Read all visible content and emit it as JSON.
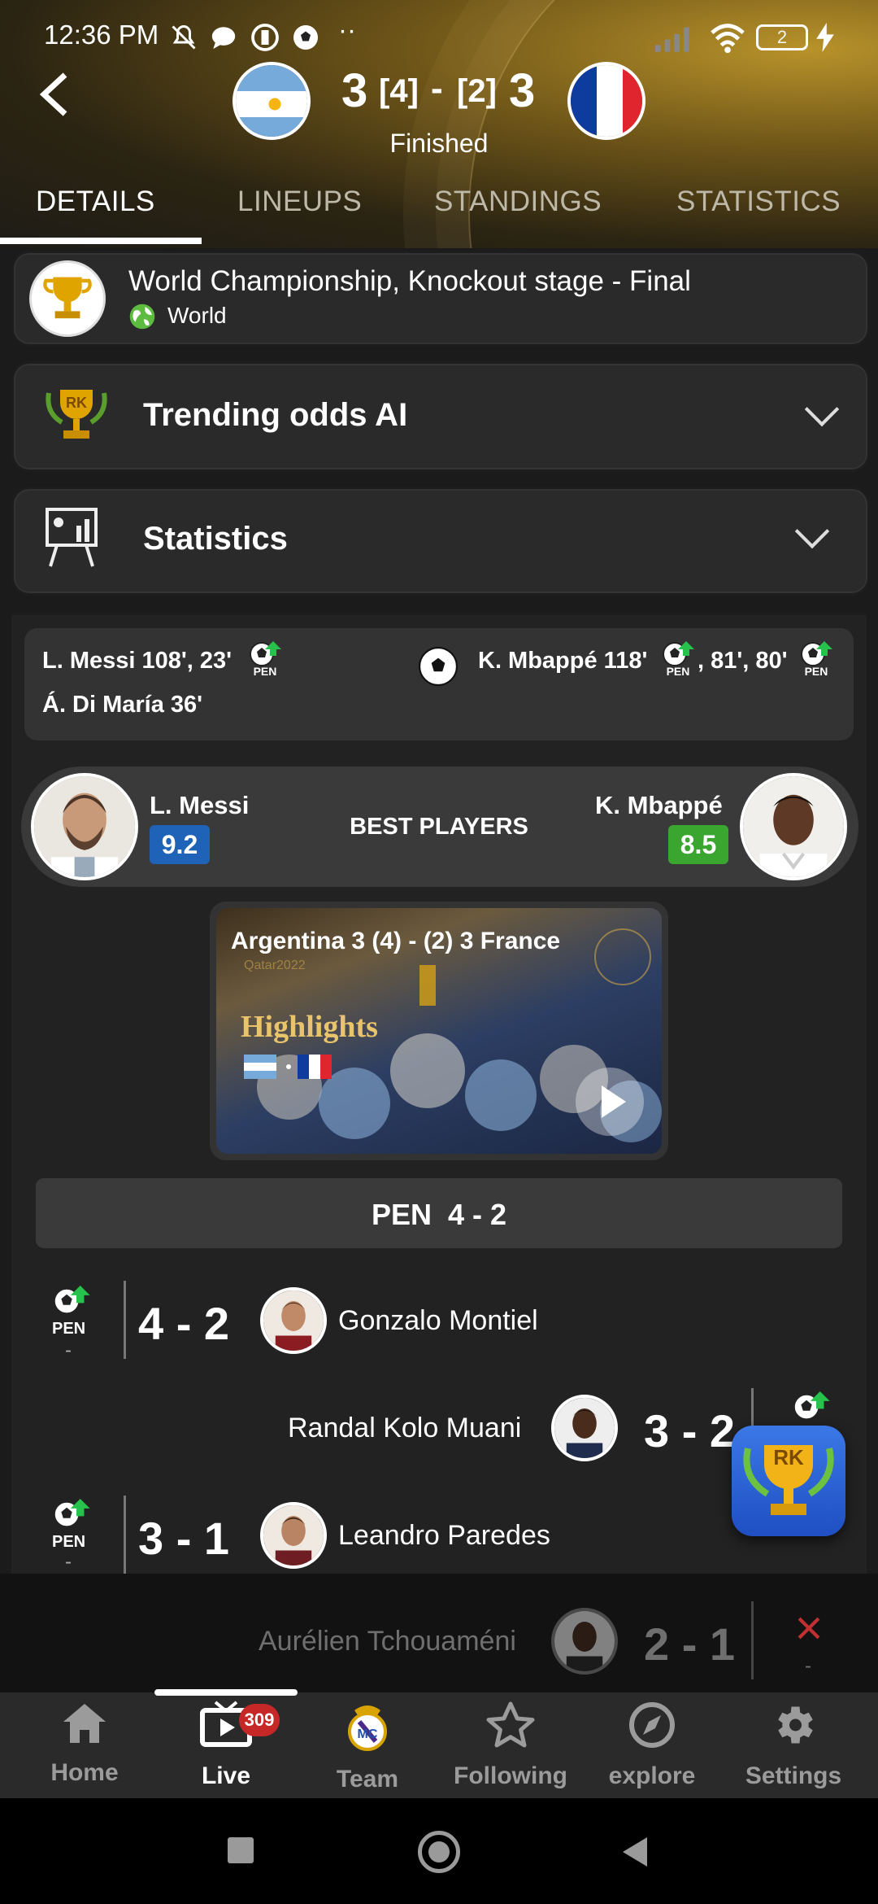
{
  "status_bar": {
    "time": "12:36 PM",
    "dots": "··",
    "battery": "2"
  },
  "match": {
    "home_score": "3",
    "away_score": "3",
    "home_pen": "[4]",
    "away_pen": "[2]",
    "separator": "-",
    "status": "Finished"
  },
  "tabs": [
    "DETAILS",
    "LINEUPS",
    "STANDINGS",
    "STATISTICS"
  ],
  "competition": {
    "title": "World Championship, Knockout stage - Final",
    "region": "World"
  },
  "trending": {
    "label": "Trending odds AI"
  },
  "statistics": {
    "label": "Statistics"
  },
  "scorers": {
    "home_line1": "L. Messi 108', 23'",
    "home_line2": "Á. Di María 36'",
    "away_line1_a": "K. Mbappé 118'",
    "away_line1_b": ", 81', 80'"
  },
  "best_players": {
    "label": "BEST PLAYERS",
    "home_name": "L. Messi",
    "home_rating": "9.2",
    "away_name": "K. Mbappé",
    "away_rating": "8.5"
  },
  "highlights": {
    "caption": "Argentina 3 (4) - (2) 3 France",
    "overlay": "Highlights",
    "watermark": "Qatar2022"
  },
  "penalties": {
    "header": "PEN  4 - 2",
    "pen_label": "PEN",
    "rows": [
      {
        "side": "home",
        "score": "4 - 2",
        "player": "Gonzalo Montiel",
        "note": "-"
      },
      {
        "side": "away",
        "score": "3 - 2",
        "player": "Randal Kolo Muani",
        "note": "-"
      },
      {
        "side": "home",
        "score": "3 - 1",
        "player": "Leandro Paredes",
        "note": "-"
      },
      {
        "side": "away",
        "score": "2 - 1",
        "player": "Aurélien Tchouaméni",
        "note": "-",
        "missed": true
      }
    ]
  },
  "fab": {
    "label": "RK"
  },
  "bottom_nav": [
    {
      "label": "Home",
      "icon": "home-icon"
    },
    {
      "label": "Live",
      "icon": "tv-icon",
      "badge": "309"
    },
    {
      "label": "Team",
      "icon": "team-crest-icon"
    },
    {
      "label": "Following",
      "icon": "star-icon"
    },
    {
      "label": "explore",
      "icon": "compass-icon"
    },
    {
      "label": "Settings",
      "icon": "gear-icon"
    }
  ],
  "colors": {
    "home_rating": "#1f63b8",
    "away_rating": "#3aa52f",
    "accent_gold": "#b8922a"
  }
}
